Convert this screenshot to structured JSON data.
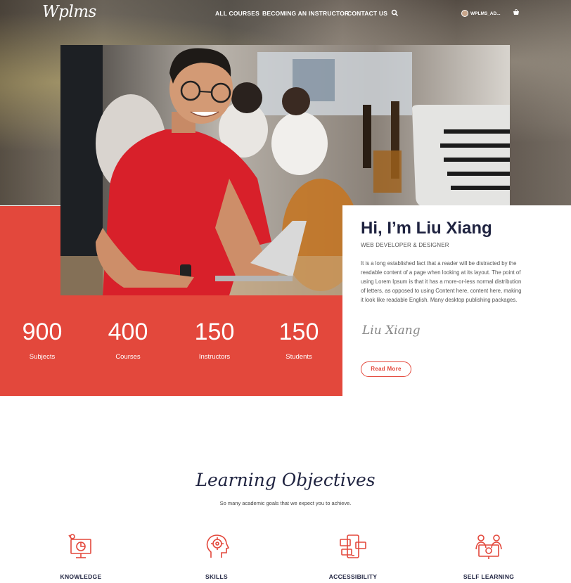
{
  "brand": {
    "logo_text": "Wplms"
  },
  "nav": {
    "items": [
      "ALL COURSES",
      "BECOMING AN INSTRUCTOR",
      "CONTACT US"
    ],
    "user_label": "WPLMS_AD..."
  },
  "stats": [
    {
      "value": "900",
      "label": "Subjects"
    },
    {
      "value": "400",
      "label": "Courses"
    },
    {
      "value": "150",
      "label": "Instructors"
    },
    {
      "value": "150",
      "label": "Students"
    }
  ],
  "about": {
    "heading": "Hi, I’m Liu Xiang",
    "role": "WEB DEVELOPER & DESIGNER",
    "description": "It is a long established fact that a reader will be distracted by the readable content of a page when looking at its layout. The point of using Lorem Ipsum is that it has a more-or-less normal distribution of letters, as opposed to using Content here, content here, making it look like readable English. Many desktop publishing packages.",
    "signature": "Liu Xiang",
    "button_label": "Read More"
  },
  "objectives": {
    "title": "Learning Objectives",
    "subtitle": "So many academic goals that we expect you to achieve.",
    "items": [
      {
        "label": "KNOWLEDGE",
        "icon": "knowledge-icon"
      },
      {
        "label": "SKILLS",
        "icon": "skills-icon"
      },
      {
        "label": "ACCESSIBILITY",
        "icon": "accessibility-icon"
      },
      {
        "label": "SELF LEARNING",
        "icon": "self-learning-icon"
      }
    ]
  },
  "colors": {
    "accent": "#e3483c",
    "heading": "#1f2340"
  }
}
